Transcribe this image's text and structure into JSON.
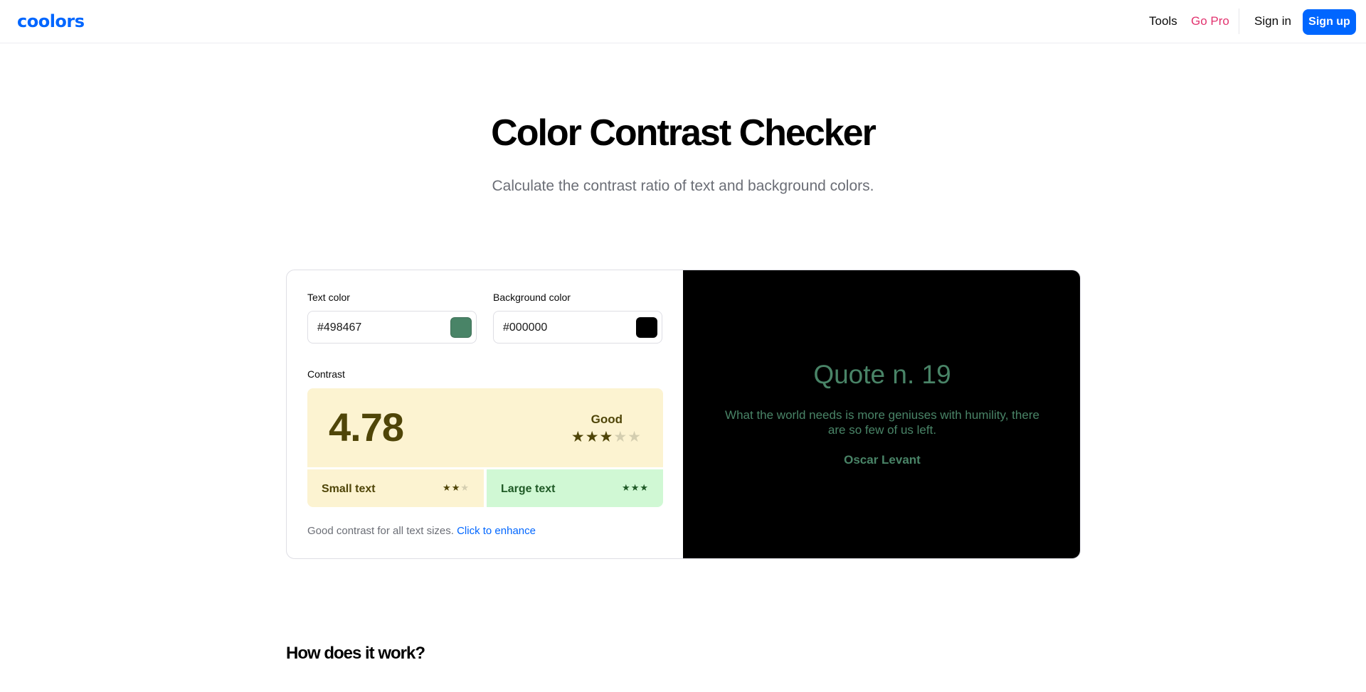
{
  "header": {
    "logo": "coolors",
    "nav": {
      "tools": "Tools",
      "go_pro": "Go Pro",
      "sign_in": "Sign in",
      "sign_up": "Sign up"
    },
    "brand_color": "#0066ff",
    "go_pro_color": "#e2336f"
  },
  "hero": {
    "title": "Color Contrast Checker",
    "subtitle": "Calculate the contrast ratio of text and background colors."
  },
  "checker": {
    "text_color_label": "Text color",
    "text_color_value": "#498467",
    "background_color_label": "Background color",
    "background_color_value": "#000000",
    "contrast_label": "Contrast",
    "ratio": "4.78",
    "rating": "Good",
    "rating_stars": 3,
    "rating_stars_max": 5,
    "small_text_label": "Small text",
    "small_text_stars": 2,
    "large_text_label": "Large text",
    "large_text_stars": 3,
    "row_stars_max": 3,
    "hint_text": "Good contrast for all text sizes.",
    "hint_link": "Click to enhance"
  },
  "preview": {
    "quote_title": "Quote n. 19",
    "quote_text": "What the world needs is more geniuses with humility, there are so few of us left.",
    "quote_author": "Oscar Levant"
  },
  "section": {
    "how_heading": "How does it work?"
  },
  "icons": {
    "star": "star-icon"
  }
}
